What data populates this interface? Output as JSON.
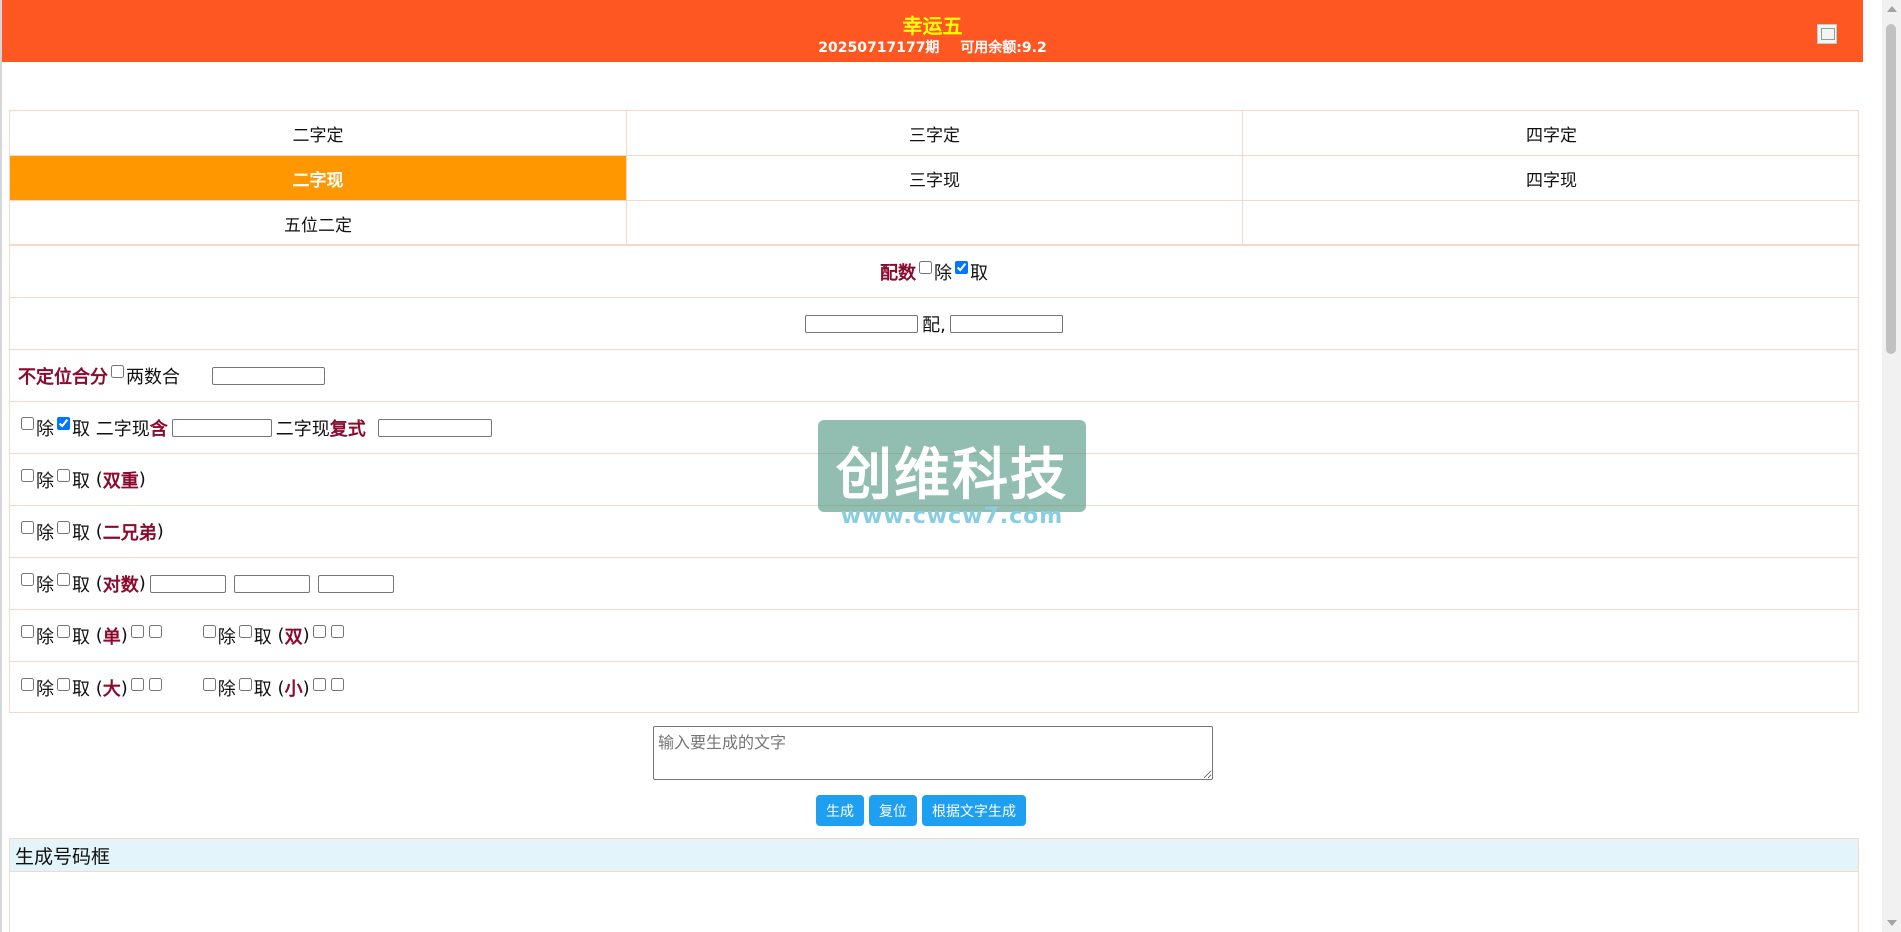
{
  "header": {
    "title": "幸运五",
    "period": "20250717177期",
    "balance": "可用余额:9.2"
  },
  "tabs": [
    {
      "label": "二字定",
      "active": false
    },
    {
      "label": "三字定",
      "active": false
    },
    {
      "label": "四字定",
      "active": false
    },
    {
      "label": "二字现",
      "active": true
    },
    {
      "label": "三字现",
      "active": false
    },
    {
      "label": "四字现",
      "active": false
    },
    {
      "label": "五位二定",
      "active": false
    },
    {
      "label": "",
      "active": false
    },
    {
      "label": "",
      "active": false
    }
  ],
  "form": {
    "peishu_label": "配数",
    "chu": "除",
    "qu": "取",
    "pei_label": "配,",
    "budingwei_label": "不定位合分",
    "liangshuhe": "两数合",
    "erzixian": "二字现",
    "han": "含",
    "fushi": "复式",
    "shuangchong": "双重",
    "erxiongdi": "二兄弟",
    "duishu": "对数",
    "dan": "单",
    "shuang": "双",
    "da": "大",
    "xiao": "小",
    "open_paren": "(",
    "close_paren": ")",
    "checks": {
      "peishu_chu": false,
      "peishu_qu": true,
      "liangshuhe": false,
      "erzixian_chu": false,
      "erzixian_qu": true
    }
  },
  "textarea": {
    "placeholder": "输入要生成的文字"
  },
  "buttons": {
    "generate": "生成",
    "reset": "复位",
    "generate_by_text": "根据文字生成"
  },
  "generated_box": {
    "title": "生成号码框"
  },
  "watermark": {
    "text": "创维科技",
    "url": "www.cwcw7.com"
  },
  "colors": {
    "header_bg": "#ff5722",
    "header_title": "#ffff00",
    "tab_active": "#ff9800",
    "highlight_text": "#8b0a2e",
    "button": "#1e9ff2",
    "border": "#f7d8c8",
    "gen_header_bg": "#e3f4fb"
  }
}
